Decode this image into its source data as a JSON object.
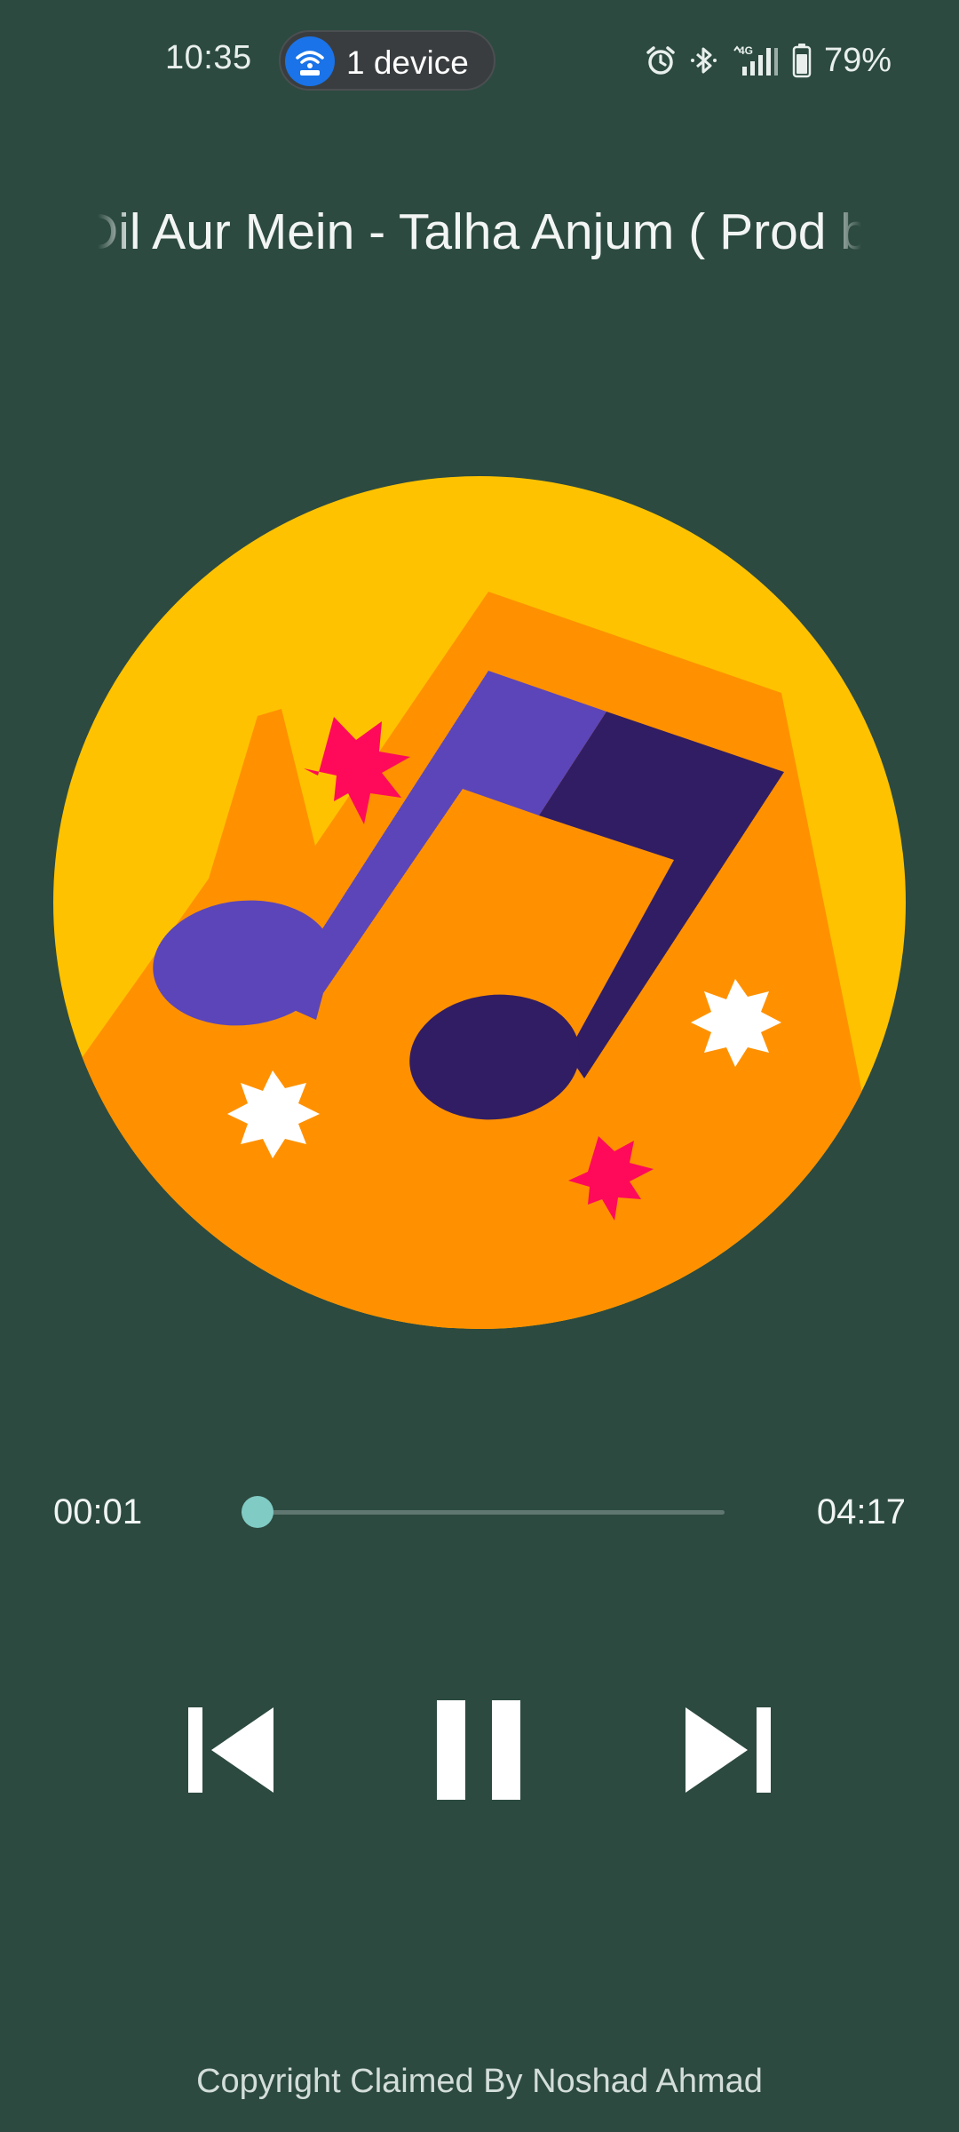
{
  "status_bar": {
    "time": "10:35",
    "device_pill_label": "1 device",
    "battery_text": "79%",
    "network_label": "4G",
    "icons": [
      "alarm-icon",
      "bluetooth-icon",
      "signal-4g-icon",
      "battery-icon"
    ]
  },
  "player": {
    "track_title": "Dil Aur Mein - Talha Anjum ( Prod by",
    "artwork_icon": "music-note-icon",
    "elapsed": "00:01",
    "duration": "04:17",
    "progress_fraction": 0.004,
    "controls": {
      "previous_icon": "skip-previous-icon",
      "pause_icon": "pause-icon",
      "next_icon": "skip-next-icon"
    }
  },
  "footer": {
    "copyright": "Copyright Claimed By Noshad Ahmad"
  },
  "colors": {
    "background": "#2c4a40",
    "accent": "#80cbc4",
    "pill_icon": "#1a73e8",
    "art_yellow": "#ffc200",
    "art_orange": "#ff9100",
    "art_purple": "#5c45b8",
    "art_dark_purple": "#311d63",
    "art_pink": "#ff0a5a"
  }
}
